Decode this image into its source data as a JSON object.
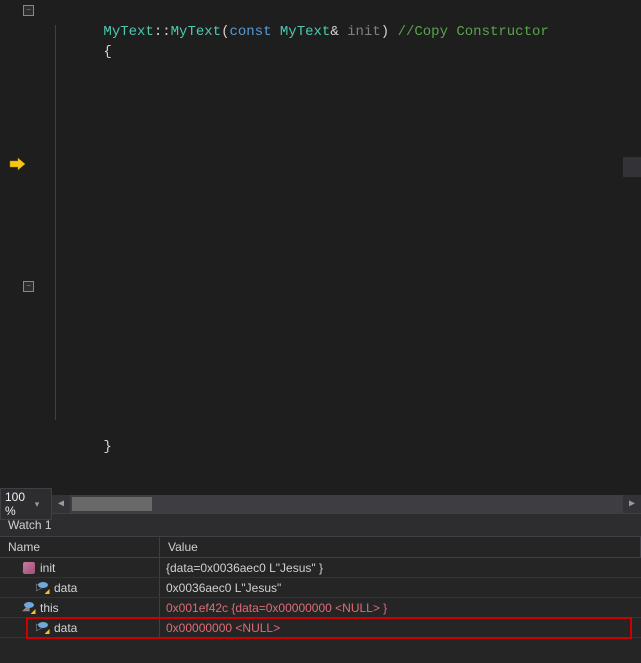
{
  "code": {
    "line1": {
      "class": "MyText",
      "scope": "::",
      "method": "MyText",
      "paren_open": "(",
      "keyword": "const ",
      "type": "MyText",
      "ref": "& ",
      "param": "init",
      "paren_close": ") ",
      "comment": "//Copy Constructor"
    },
    "brace_open": "{",
    "brace_close": "}",
    "outline_minus": "−",
    "outline_minus2": "−"
  },
  "zoom": {
    "value": "100 %",
    "arrow": "▾"
  },
  "watch": {
    "title": "Watch 1",
    "header_name": "Name",
    "header_value": "Value",
    "rows": [
      {
        "expand": "◢",
        "icon": "struct",
        "name": "init",
        "value": "{data=0x0036aec0 L\"Jesus\" }",
        "red": false,
        "indent": 1
      },
      {
        "expand": "▷",
        "icon": "member",
        "name": "data",
        "value": "0x0036aec0 L\"Jesus\"",
        "red": false,
        "indent": 2
      },
      {
        "expand": "◢",
        "icon": "member",
        "name": "this",
        "value": "0x001ef42c {data=0x00000000 <NULL> }",
        "red": true,
        "indent": 1
      },
      {
        "expand": "▷",
        "icon": "member",
        "name": "data",
        "value": "0x00000000 <NULL>",
        "red": true,
        "indent": 2
      }
    ]
  }
}
